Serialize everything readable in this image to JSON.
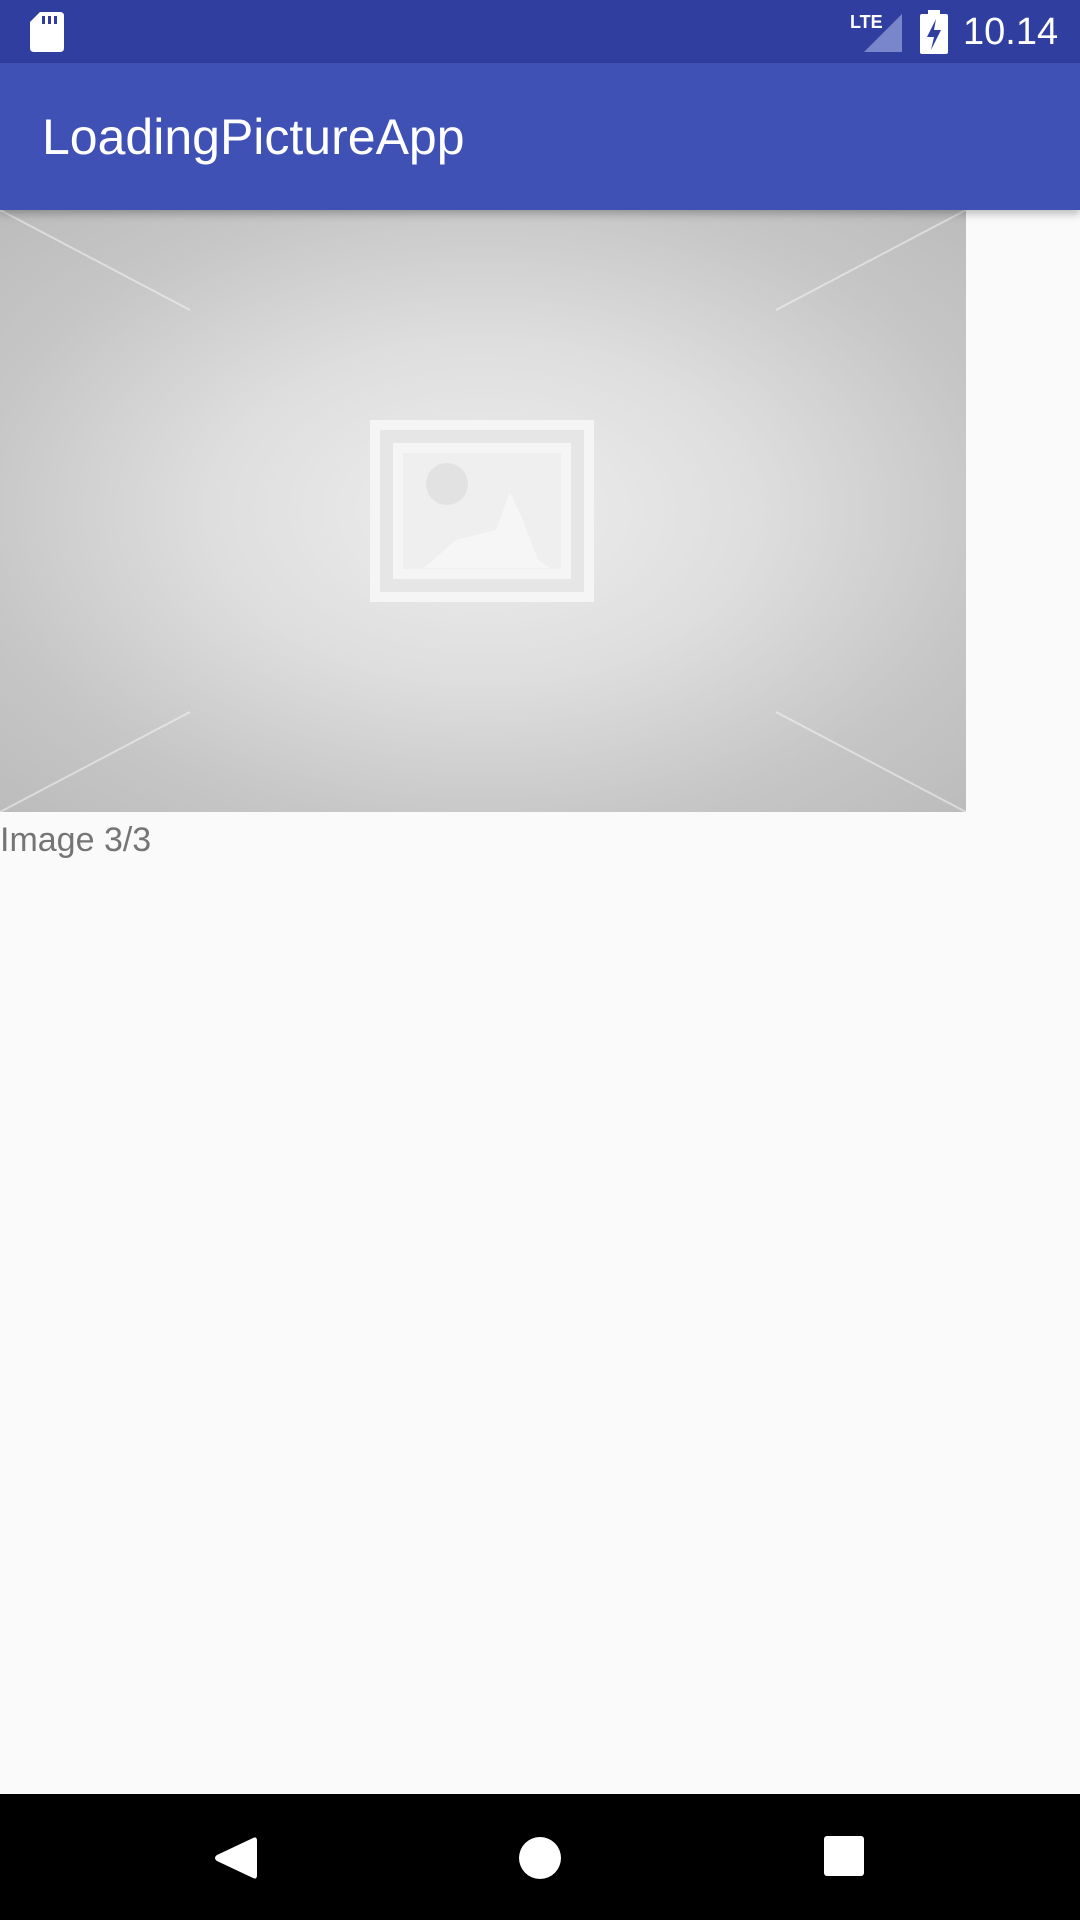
{
  "status_bar": {
    "time": "10.14",
    "network": "LTE",
    "icons": [
      "sd-card-icon",
      "lte-signal-icon",
      "battery-charging-icon"
    ],
    "background": "#303f9f"
  },
  "app_bar": {
    "title": "LoadingPictureApp",
    "background": "#3f51b5"
  },
  "main": {
    "image": {
      "icon": "image-placeholder-icon"
    },
    "caption": "Image 3/3"
  },
  "navigation_bar": {
    "buttons": [
      "back-icon",
      "home-icon",
      "recent-apps-icon"
    ],
    "background": "#000000"
  }
}
